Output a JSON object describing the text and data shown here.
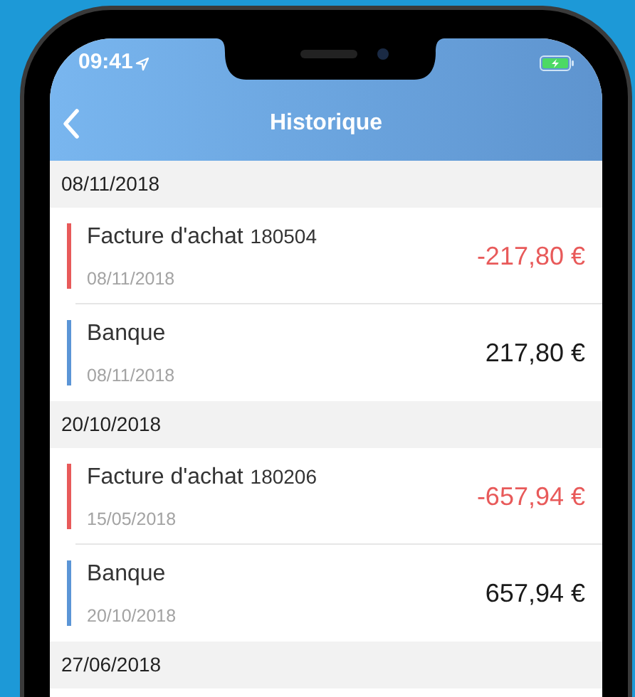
{
  "status_bar": {
    "time": "09:41"
  },
  "nav_bar": {
    "title": "Historique"
  },
  "sections": [
    {
      "date": "08/11/2018",
      "entries": [
        {
          "kind": "purchase",
          "title": "Facture d'achat",
          "reference": "180504",
          "date": "08/11/2018",
          "amount": "-217,80 €",
          "color": "#e85a5a"
        },
        {
          "kind": "bank",
          "title": "Banque",
          "date": "08/11/2018",
          "amount": "217,80 €",
          "color": "#5b95d6"
        }
      ]
    },
    {
      "date": "20/10/2018",
      "entries": [
        {
          "kind": "purchase",
          "title": "Facture d'achat",
          "reference": "180206",
          "date": "15/05/2018",
          "amount": "-657,94 €",
          "color": "#e85a5a"
        },
        {
          "kind": "bank",
          "title": "Banque",
          "date": "20/10/2018",
          "amount": "657,94 €",
          "color": "#5b95d6"
        }
      ]
    },
    {
      "date": "27/06/2018"
    }
  ]
}
